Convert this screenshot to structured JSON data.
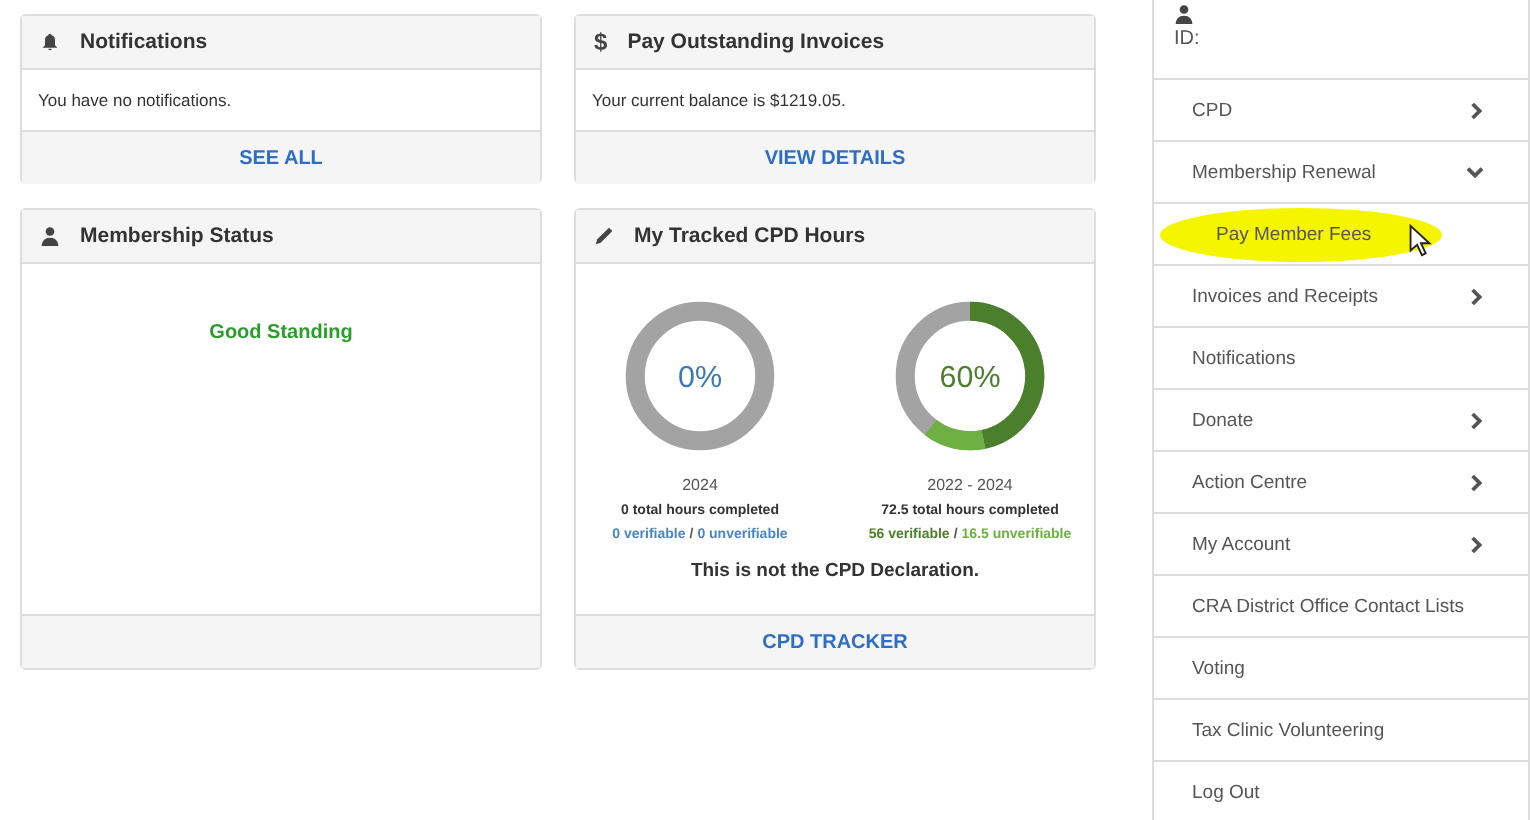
{
  "panels": [
    {
      "kind": "notifications",
      "title": "Notifications",
      "text": "You have no notifications.",
      "footer_link": "SEE ALL"
    },
    {
      "kind": "invoices",
      "title": "Pay Outstanding Invoices",
      "dollar": "$",
      "text": "Your current balance is $1219.05.",
      "footer_link": "VIEW DETAILS"
    },
    {
      "kind": "status",
      "title": "Membership Status",
      "status": "Good Standing"
    },
    {
      "kind": "cpd",
      "title": "My Tracked CPD Hours",
      "rings": [
        {
          "percent": "0%",
          "period": "2024",
          "total": "0 total hours completed",
          "verifiable": "0 verifiable",
          "separator": "/",
          "unverifiable": "0 unverifiable"
        },
        {
          "percent": "60%",
          "period": "2022 - 2024",
          "total": "72.5 total hours completed",
          "verifiable": "56 verifiable",
          "separator": "/",
          "unverifiable": "16.5 unverifiable",
          "segments": [
            {
              "kind": "verifiable",
              "level": 0.4667,
              "color": "#4b7f2b"
            },
            {
              "kind": "unverifiable",
              "level": 0.1375,
              "color": "#6fb043"
            }
          ]
        }
      ],
      "note": "This is not the CPD Declaration.",
      "footer_link": "CPD TRACKER"
    }
  ],
  "sidebar": {
    "id_label": "ID:",
    "items": [
      {
        "label": "CPD",
        "kind": "submenu",
        "expanded": false
      },
      {
        "label": "Membership Renewal",
        "kind": "submenu",
        "expanded": true,
        "children": [
          {
            "label": "Pay Member Fees",
            "highlighted": true,
            "pointer": true
          }
        ]
      },
      {
        "label": "Invoices and Receipts",
        "kind": "submenu",
        "expanded": false
      },
      {
        "label": "Notifications",
        "kind": "link"
      },
      {
        "label": "Donate",
        "kind": "submenu",
        "expanded": false
      },
      {
        "label": "Action Centre",
        "kind": "submenu",
        "expanded": false
      },
      {
        "label": "My Account",
        "kind": "submenu",
        "expanded": false
      },
      {
        "label": "CRA District Office Contact Lists",
        "kind": "link"
      },
      {
        "label": "Voting",
        "kind": "link"
      },
      {
        "label": "Tax Clinic Volunteering",
        "kind": "link"
      },
      {
        "label": "Log Out",
        "kind": "link"
      }
    ]
  }
}
